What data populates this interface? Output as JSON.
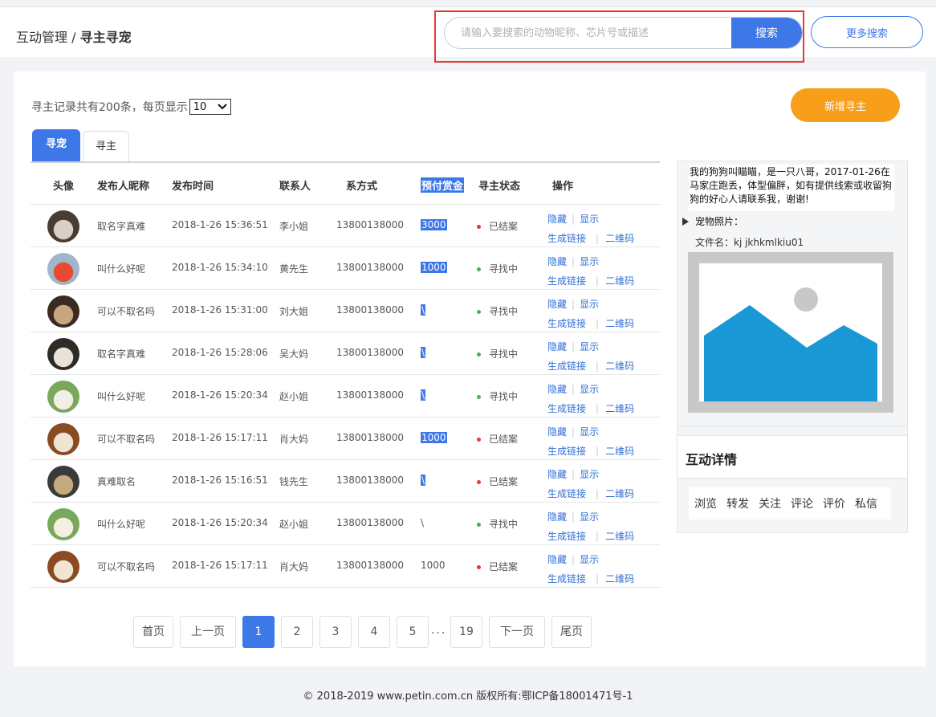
{
  "breadcrumb": {
    "parent": "互动管理",
    "separator": "/",
    "current": "寻主寻宠"
  },
  "search": {
    "placeholder": "请输入要搜索的动物昵称、芯片号或描述",
    "button": "搜索",
    "more": "更多搜索"
  },
  "summary": {
    "text": "寻主记录共有200条，每页显示",
    "page_size": "10"
  },
  "add_button": "新增寻主",
  "tabs": [
    {
      "label": "寻宠"
    },
    {
      "label": "寻主"
    }
  ],
  "table": {
    "headers": {
      "avatar": "头像",
      "nickname": "发布人昵称",
      "time": "发布时间",
      "contact": "联系人",
      "phone": "系方式",
      "reward": "预付赏金",
      "status": "寻主状态",
      "ops": "操作"
    },
    "ops_labels": {
      "hide": "隐藏",
      "show": "显示",
      "link": "生成链接",
      "qrcode": "二维码"
    },
    "rows": [
      {
        "nickname": "取名字真难",
        "time": "2018-1-26  15:36:51",
        "contact": "李小姐",
        "phone": "13800138000",
        "reward": "3000",
        "reward_hl": true,
        "status": "已结案",
        "status_color": "#e53935"
      },
      {
        "nickname": "叫什么好呢",
        "time": "2018-1-26  15:34:10",
        "contact": "黄先生",
        "phone": "13800138000",
        "reward": "1000",
        "reward_hl": true,
        "status": "寻找中",
        "status_color": "#4caf50"
      },
      {
        "nickname": "可以不取名吗",
        "time": "2018-1-26  15:31:00",
        "contact": "刘大姐",
        "phone": "13800138000",
        "reward": "\\",
        "reward_hl": true,
        "status": "寻找中",
        "status_color": "#4caf50"
      },
      {
        "nickname": "取名字真难",
        "time": "2018-1-26  15:28:06",
        "contact": "吴大妈",
        "phone": "13800138000",
        "reward": "\\",
        "reward_hl": true,
        "status": "寻找中",
        "status_color": "#4caf50"
      },
      {
        "nickname": "叫什么好呢",
        "time": "2018-1-26  15:20:34",
        "contact": "赵小姐",
        "phone": "13800138000",
        "reward": "\\",
        "reward_hl": true,
        "status": "寻找中",
        "status_color": "#4caf50"
      },
      {
        "nickname": "可以不取名吗",
        "time": "2018-1-26  15:17:11",
        "contact": "肖大妈",
        "phone": "13800138000",
        "reward": "1000",
        "reward_hl": true,
        "status": "已结案",
        "status_color": "#e53935"
      },
      {
        "nickname": "真难取名",
        "time": "2018-1-26  15:16:51",
        "contact": "钱先生",
        "phone": "13800138000",
        "reward": "\\",
        "reward_hl": true,
        "status": "已结案",
        "status_color": "#e53935"
      },
      {
        "nickname": "叫什么好呢",
        "time": "2018-1-26  15:20:34",
        "contact": "赵小姐",
        "phone": "13800138000",
        "reward": "\\",
        "reward_hl": false,
        "status": "寻找中",
        "status_color": "#4caf50"
      },
      {
        "nickname": "可以不取名吗",
        "time": "2018-1-26  15:17:11",
        "contact": "肖大妈",
        "phone": "13800138000",
        "reward": "1000",
        "reward_hl": false,
        "status": "已结案",
        "status_color": "#e53935"
      }
    ]
  },
  "side": {
    "description": "我的狗狗叫瞄瞄，是一只八哥，2017-01-26在马家庄跑丢，体型偏胖，如有提供线索或收留狗狗的好心人请联系我，谢谢!",
    "photo_label": "宠物照片：",
    "file_name": "文件名：kj jkhkmlkiu01",
    "interaction_title": "互动详情",
    "actions": [
      "浏览",
      "转发",
      "关注",
      "评论",
      "评价",
      "私信"
    ]
  },
  "pagination": {
    "first": "首页",
    "prev": "上一页",
    "pages": [
      "1",
      "2",
      "3",
      "4",
      "5"
    ],
    "ellipsis": "...",
    "last_page": "19",
    "next": "下一页",
    "end": "尾页",
    "current": "1"
  },
  "footer": "© 2018-2019 www.petin.com.cn 版权所有:鄂ICP备18001471号-1",
  "colors": {
    "primary": "#3e78e8",
    "accent": "#f79e1b",
    "alert": "#e53935",
    "ok": "#4caf50"
  }
}
